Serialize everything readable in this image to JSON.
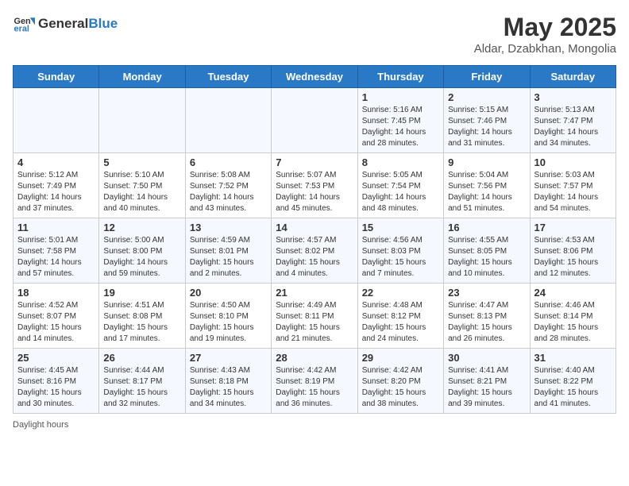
{
  "header": {
    "logo_general": "General",
    "logo_blue": "Blue",
    "month": "May 2025",
    "location": "Aldar, Dzabkhan, Mongolia"
  },
  "days_of_week": [
    "Sunday",
    "Monday",
    "Tuesday",
    "Wednesday",
    "Thursday",
    "Friday",
    "Saturday"
  ],
  "weeks": [
    [
      {
        "day": "",
        "detail": ""
      },
      {
        "day": "",
        "detail": ""
      },
      {
        "day": "",
        "detail": ""
      },
      {
        "day": "",
        "detail": ""
      },
      {
        "day": "1",
        "detail": "Sunrise: 5:16 AM\nSunset: 7:45 PM\nDaylight: 14 hours\nand 28 minutes."
      },
      {
        "day": "2",
        "detail": "Sunrise: 5:15 AM\nSunset: 7:46 PM\nDaylight: 14 hours\nand 31 minutes."
      },
      {
        "day": "3",
        "detail": "Sunrise: 5:13 AM\nSunset: 7:47 PM\nDaylight: 14 hours\nand 34 minutes."
      }
    ],
    [
      {
        "day": "4",
        "detail": "Sunrise: 5:12 AM\nSunset: 7:49 PM\nDaylight: 14 hours\nand 37 minutes."
      },
      {
        "day": "5",
        "detail": "Sunrise: 5:10 AM\nSunset: 7:50 PM\nDaylight: 14 hours\nand 40 minutes."
      },
      {
        "day": "6",
        "detail": "Sunrise: 5:08 AM\nSunset: 7:52 PM\nDaylight: 14 hours\nand 43 minutes."
      },
      {
        "day": "7",
        "detail": "Sunrise: 5:07 AM\nSunset: 7:53 PM\nDaylight: 14 hours\nand 45 minutes."
      },
      {
        "day": "8",
        "detail": "Sunrise: 5:05 AM\nSunset: 7:54 PM\nDaylight: 14 hours\nand 48 minutes."
      },
      {
        "day": "9",
        "detail": "Sunrise: 5:04 AM\nSunset: 7:56 PM\nDaylight: 14 hours\nand 51 minutes."
      },
      {
        "day": "10",
        "detail": "Sunrise: 5:03 AM\nSunset: 7:57 PM\nDaylight: 14 hours\nand 54 minutes."
      }
    ],
    [
      {
        "day": "11",
        "detail": "Sunrise: 5:01 AM\nSunset: 7:58 PM\nDaylight: 14 hours\nand 57 minutes."
      },
      {
        "day": "12",
        "detail": "Sunrise: 5:00 AM\nSunset: 8:00 PM\nDaylight: 14 hours\nand 59 minutes."
      },
      {
        "day": "13",
        "detail": "Sunrise: 4:59 AM\nSunset: 8:01 PM\nDaylight: 15 hours\nand 2 minutes."
      },
      {
        "day": "14",
        "detail": "Sunrise: 4:57 AM\nSunset: 8:02 PM\nDaylight: 15 hours\nand 4 minutes."
      },
      {
        "day": "15",
        "detail": "Sunrise: 4:56 AM\nSunset: 8:03 PM\nDaylight: 15 hours\nand 7 minutes."
      },
      {
        "day": "16",
        "detail": "Sunrise: 4:55 AM\nSunset: 8:05 PM\nDaylight: 15 hours\nand 10 minutes."
      },
      {
        "day": "17",
        "detail": "Sunrise: 4:53 AM\nSunset: 8:06 PM\nDaylight: 15 hours\nand 12 minutes."
      }
    ],
    [
      {
        "day": "18",
        "detail": "Sunrise: 4:52 AM\nSunset: 8:07 PM\nDaylight: 15 hours\nand 14 minutes."
      },
      {
        "day": "19",
        "detail": "Sunrise: 4:51 AM\nSunset: 8:08 PM\nDaylight: 15 hours\nand 17 minutes."
      },
      {
        "day": "20",
        "detail": "Sunrise: 4:50 AM\nSunset: 8:10 PM\nDaylight: 15 hours\nand 19 minutes."
      },
      {
        "day": "21",
        "detail": "Sunrise: 4:49 AM\nSunset: 8:11 PM\nDaylight: 15 hours\nand 21 minutes."
      },
      {
        "day": "22",
        "detail": "Sunrise: 4:48 AM\nSunset: 8:12 PM\nDaylight: 15 hours\nand 24 minutes."
      },
      {
        "day": "23",
        "detail": "Sunrise: 4:47 AM\nSunset: 8:13 PM\nDaylight: 15 hours\nand 26 minutes."
      },
      {
        "day": "24",
        "detail": "Sunrise: 4:46 AM\nSunset: 8:14 PM\nDaylight: 15 hours\nand 28 minutes."
      }
    ],
    [
      {
        "day": "25",
        "detail": "Sunrise: 4:45 AM\nSunset: 8:16 PM\nDaylight: 15 hours\nand 30 minutes."
      },
      {
        "day": "26",
        "detail": "Sunrise: 4:44 AM\nSunset: 8:17 PM\nDaylight: 15 hours\nand 32 minutes."
      },
      {
        "day": "27",
        "detail": "Sunrise: 4:43 AM\nSunset: 8:18 PM\nDaylight: 15 hours\nand 34 minutes."
      },
      {
        "day": "28",
        "detail": "Sunrise: 4:42 AM\nSunset: 8:19 PM\nDaylight: 15 hours\nand 36 minutes."
      },
      {
        "day": "29",
        "detail": "Sunrise: 4:42 AM\nSunset: 8:20 PM\nDaylight: 15 hours\nand 38 minutes."
      },
      {
        "day": "30",
        "detail": "Sunrise: 4:41 AM\nSunset: 8:21 PM\nDaylight: 15 hours\nand 39 minutes."
      },
      {
        "day": "31",
        "detail": "Sunrise: 4:40 AM\nSunset: 8:22 PM\nDaylight: 15 hours\nand 41 minutes."
      }
    ]
  ],
  "footer": {
    "daylight_hours": "Daylight hours"
  }
}
